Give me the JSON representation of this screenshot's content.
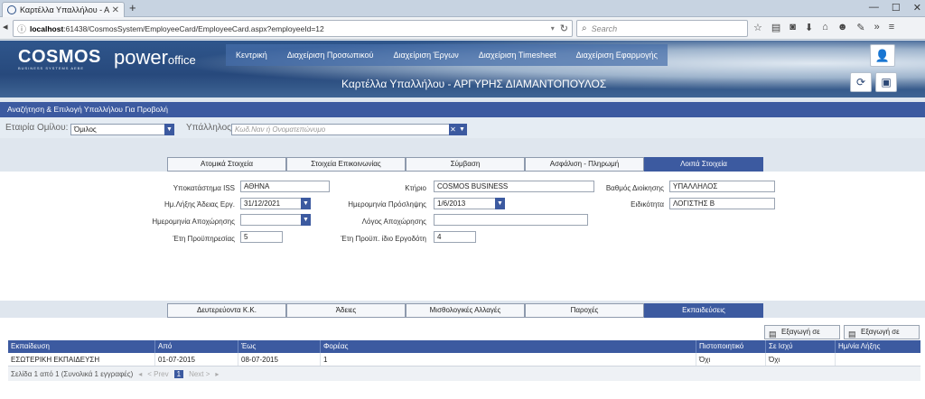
{
  "browser": {
    "tab_title": "Καρτέλλα Υπαλλήλου - ΑΡ...",
    "url_host": "localhost",
    "url_path": ":61438/CosmosSystem/EmployeeCard/EmployeeCard.aspx?employeeId=12",
    "search_placeholder": "Search"
  },
  "header": {
    "brand": "COSMOS",
    "brand_tagline": "BUSINESS SYSTEMS AEBE",
    "product_main": "power",
    "product_sub": "office",
    "menu": [
      "Κεντρική",
      "Διαχείριση Προσωπικού",
      "Διαχείριση Έργων",
      "Διαχείριση Timesheet",
      "Διαχείριση Εφαρμογής"
    ],
    "page_title": "Καρτέλλα Υπαλλήλου - ΑΡΓΥΡΗΣ ΔΙΑΜΑΝΤΟΠΟΥΛΟΣ"
  },
  "search_panel": {
    "heading": "Αναζήτηση & Επιλογή Υπαλλήλου Για Προβολή",
    "company_label": "Εταιρία Ομίλου:",
    "company_value": "Όμιλος",
    "employee_label": "Υπάλληλος:",
    "employee_placeholder": "Κωδ.Ναν ή Ονοματεπώνυμο"
  },
  "top_tabs": [
    "Ατομικά Στοιχεία",
    "Στοιχεία Επικοινωνίας",
    "Σύμβαση",
    "Ασφάλιση - Πληρωμή",
    "Λοιπά Στοιχεία"
  ],
  "top_tabs_active": 4,
  "fields": {
    "branch_label": "Υποκατάστημα ISS",
    "branch_value": "ΑΘΗΝΑ",
    "building_label": "Κτήριο",
    "building_value": "COSMOS BUSINESS",
    "grade_label": "Βαθμός Διοίκησης",
    "grade_value": "ΥΠΑΛΛΗΛΟΣ",
    "leave_end_label": "Ημ.Λήξης Άδειας Εργ.",
    "leave_end_value": "31/12/2021",
    "hire_date_label": "Ημερομηνία Πρόσληψης",
    "hire_date_value": "1/6/2013",
    "specialty_label": "Ειδικότητα",
    "specialty_value": "ΛΟΓΙΣΤΗΣ Β",
    "departure_date_label": "Ημερομηνία Αποχώρησης",
    "departure_date_value": "",
    "departure_reason_label": "Λόγος Αποχώρησης",
    "departure_reason_value": "",
    "prior_years_label": "Έτη Προϋπηρεσίας",
    "prior_years_value": "5",
    "prior_same_label": "Έτη Προϋπ. ίδιο Εργοδότη",
    "prior_same_value": "4"
  },
  "bottom_tabs": [
    "Δευτερεύοντα Κ.Κ.",
    "Άδειες",
    "Μισθολογικές Αλλαγές",
    "Παροχές",
    "Εκπαιδεύσεις"
  ],
  "bottom_tabs_active": 4,
  "export": {
    "pdf": "Εξαγωγή σε PDF",
    "xls": "Εξαγωγή σε XLS"
  },
  "grid": {
    "columns": [
      "Εκπαίδευση",
      "Από",
      "Έως",
      "Φορέας",
      "Πιστοποιητικό",
      "Σε Ισχύ",
      "Ημ/νία Λήξης"
    ],
    "rows": [
      [
        "ΕΣΩΤΕΡΙΚΗ ΕΚΠΑΙΔΕΥΣΗ",
        "01-07-2015",
        "08-07-2015",
        "1",
        "Όχι",
        "Όχι",
        ""
      ]
    ],
    "pager": {
      "summary": "Σελίδα 1 από 1 (Συνολικά 1 εγγραφές)",
      "prev": "< Prev",
      "page": "1",
      "next": "Next >"
    }
  }
}
